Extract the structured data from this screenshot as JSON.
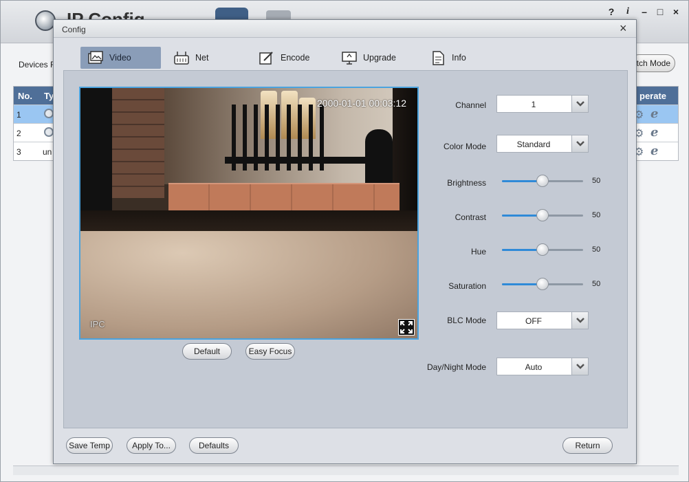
{
  "main": {
    "title": "IP Config",
    "devices_label": "Devices F",
    "batch_mode_label": "tch Mode",
    "table": {
      "headers": [
        "No.",
        "Ty",
        "perate"
      ],
      "rows": [
        {
          "no": "1",
          "type": "",
          "selected": true
        },
        {
          "no": "2",
          "type": "",
          "selected": false
        },
        {
          "no": "3",
          "type": "un",
          "selected": false
        }
      ]
    },
    "window_controls": {
      "help": "?",
      "info": "i",
      "minimize": "–",
      "maximize": "□",
      "close": "×"
    }
  },
  "dialog": {
    "title": "Config",
    "close": "×",
    "tabs": [
      {
        "label": "Video",
        "icon": "picture-icon",
        "active": true
      },
      {
        "label": "Net",
        "icon": "router-icon",
        "active": false
      },
      {
        "label": "Encode",
        "icon": "edit-icon",
        "active": false
      },
      {
        "label": "Upgrade",
        "icon": "monitor-upload-icon",
        "active": false
      },
      {
        "label": "Info",
        "icon": "document-icon",
        "active": false
      }
    ],
    "preview": {
      "timestamp": "2000-01-01 00:03:12",
      "overlay": "IPC"
    },
    "preview_buttons": {
      "default": "Default",
      "easy_focus": "Easy Focus"
    },
    "settings": {
      "channel": {
        "label": "Channel",
        "value": "1"
      },
      "color_mode": {
        "label": "Color Mode",
        "value": "Standard"
      },
      "brightness": {
        "label": "Brightness",
        "value": 50
      },
      "contrast": {
        "label": "Contrast",
        "value": 50
      },
      "hue": {
        "label": "Hue",
        "value": 50
      },
      "saturation": {
        "label": "Saturation",
        "value": 50
      },
      "blc_mode": {
        "label": "BLC Mode",
        "value": "OFF"
      },
      "day_night_mode": {
        "label": "Day/Night Mode",
        "value": "Auto"
      }
    },
    "footer": {
      "save_temp": "Save Temp",
      "apply_to": "Apply To...",
      "defaults": "Defaults",
      "return": "Return"
    }
  },
  "colors": {
    "accent": "#4f6f98",
    "selection": "#9ac6f2",
    "slider_fill": "#2f8ad8",
    "panel": "#c4cad4"
  }
}
